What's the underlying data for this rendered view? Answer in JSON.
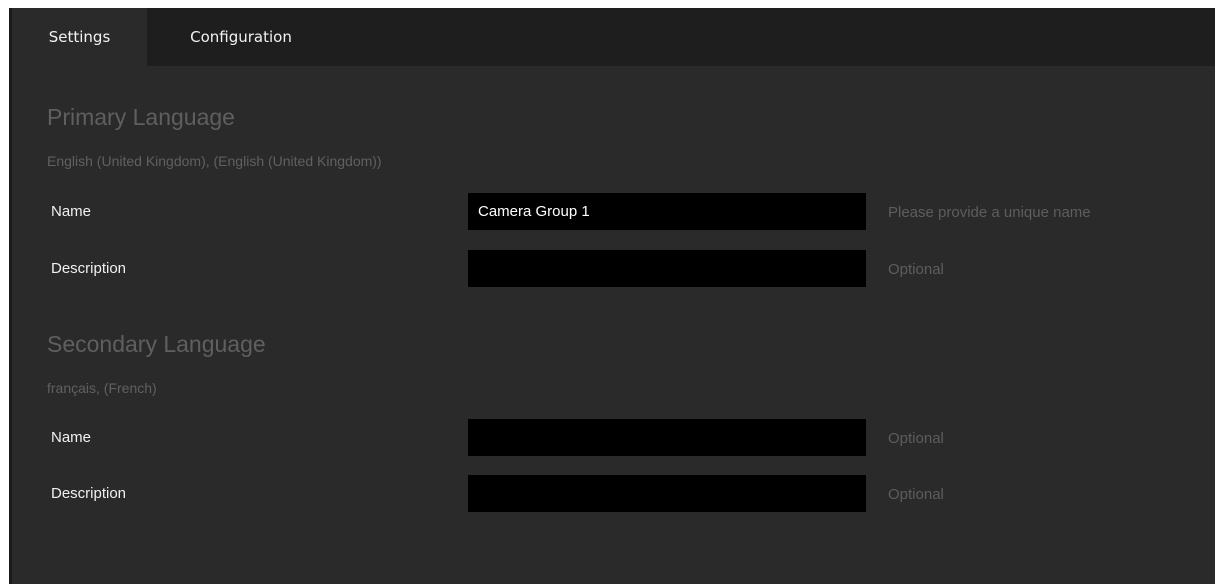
{
  "tabs": {
    "settings": "Settings",
    "configuration": "Configuration"
  },
  "primary": {
    "title": "Primary Language",
    "language": "English (United Kingdom), (English (United Kingdom))",
    "name_label": "Name",
    "name_value": "Camera Group 1",
    "name_hint": "Please provide a unique name",
    "description_label": "Description",
    "description_value": "",
    "description_hint": "Optional"
  },
  "secondary": {
    "title": "Secondary Language",
    "language": "français, (French)",
    "name_label": "Name",
    "name_value": "",
    "name_hint": "Optional",
    "description_label": "Description",
    "description_value": "",
    "description_hint": "Optional"
  },
  "colors": {
    "panel_background": "#2a2a2a",
    "tabbar_background": "#1e1e1e",
    "input_background": "#000000",
    "label_text": "#f0f0f0",
    "muted_text": "#5f5f5f"
  }
}
